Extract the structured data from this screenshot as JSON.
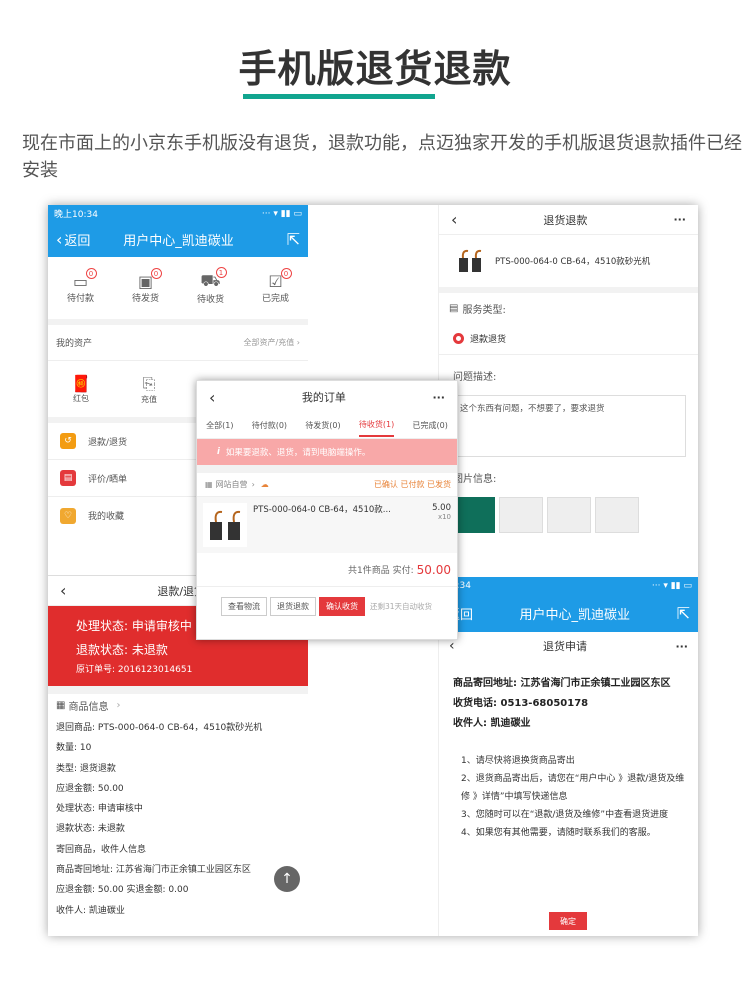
{
  "header": {
    "title": "手机版退货退款",
    "intro": "现在市面上的小京东手机版没有退货，退款功能，点迈独家开发的手机版退货退款插件已经安装"
  },
  "colors": {
    "accent": "#11a58f",
    "blue": "#1e9be6",
    "red": "#e4393c"
  },
  "user_center": {
    "status_time": "晚上10:34",
    "back_label": "返回",
    "title": "用户中心_凯迪碳业",
    "orders": [
      {
        "label": "待付款",
        "count": "0"
      },
      {
        "label": "待发货",
        "count": "0"
      },
      {
        "label": "待收货",
        "count": "1"
      },
      {
        "label": "已完成",
        "count": "0"
      }
    ],
    "assets_label": "我的资产",
    "assets_link": "全部资产/充值",
    "assets": [
      {
        "label": "红包",
        "icon": "gift-icon"
      },
      {
        "label": "充值",
        "icon": "recharge-icon"
      }
    ],
    "menu": [
      {
        "label": "退款/退货",
        "icon": "return-icon"
      },
      {
        "label": "评价/晒单",
        "icon": "comment-icon"
      },
      {
        "label": "我的收藏",
        "icon": "favorite-icon"
      }
    ]
  },
  "refund_detail": {
    "title": "退款/退货",
    "status1": "处理状态: 申请审核中",
    "status2": "退款状态: 未退款",
    "order_no": "原订单号: 2016123014651",
    "section": "商品信息",
    "lines": [
      "退回商品: PTS-000-064-0 CB-64，4510款砂光机",
      "数量: 10",
      "类型: 退货退款",
      "应退金额: 50.00",
      "处理状态: 申请审核中",
      "退款状态: 未退款",
      "寄回商品，收件人信息",
      "商品寄回地址: 江苏省海门市正余镇工业园区东区",
      "应退金额: 50.00    实退金额: 0.00",
      "收件人: 凯迪碳业"
    ]
  },
  "my_orders": {
    "title": "我的订单",
    "tabs": [
      "全部(1)",
      "待付款(0)",
      "待发货(0)",
      "待收货(1)",
      "已完成(0)"
    ],
    "notice": "如果要退款、退货，请到电脑端操作。",
    "shop": "网站自营",
    "status": "已确认 已付款 已发货",
    "product": "PTS-000-064-0 CB-64，4510款...",
    "price": "5.00",
    "qty": "x10",
    "summary": "共1件商品  实付:",
    "total": "50.00",
    "buttons": [
      "查看物流",
      "退货退款",
      "确认收货"
    ],
    "auto": "还剩31天自动收货"
  },
  "return_form": {
    "title": "退货退款",
    "product": "PTS-000-064-0 CB-64，4510款砂光机",
    "service_label": "服务类型:",
    "service_option": "退款退货",
    "desc_label": "问题描述:",
    "desc_value": "这个东西有问题，不想要了，要求退货",
    "img_label": "图片信息:"
  },
  "apply": {
    "status_time": "10:34",
    "back_label": "返回",
    "title": "用户中心_凯迪碳业",
    "sub_title": "退货申请",
    "address": "商品寄回地址: 江苏省海门市正余镇工业园区东区",
    "phone": "收货电话: 0513-68050178",
    "receiver": "收件人: 凯迪碳业",
    "steps": [
      "1、请尽快将退换货商品寄出",
      "2、退货商品寄出后，请您在“用户中心 》退款/退货及维修 》详情”中填写快递信息",
      "3、您随时可以在“退款/退货及维修”中查看退货进度",
      "4、如果您有其他需要，请随时联系我们的客服。"
    ],
    "confirm": "确定"
  }
}
